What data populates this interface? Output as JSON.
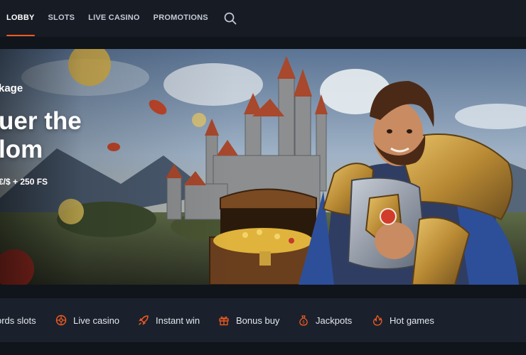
{
  "nav": {
    "items": [
      {
        "label": "LOBBY",
        "active": true
      },
      {
        "label": "SLOTS",
        "active": false
      },
      {
        "label": "LIVE CASINO",
        "active": false
      },
      {
        "label": "PROMOTIONS",
        "active": false
      }
    ],
    "search_icon": "search-icon"
  },
  "hero": {
    "kicker": "kage",
    "title_line1": "uer the",
    "title_line2": "lom",
    "offer": "€/$ + 250 FS"
  },
  "categories": [
    {
      "label": "ords slots",
      "icon": "none"
    },
    {
      "label": "Live casino",
      "icon": "roulette-icon"
    },
    {
      "label": "Instant win",
      "icon": "rocket-icon"
    },
    {
      "label": "Bonus buy",
      "icon": "gift-icon"
    },
    {
      "label": "Jackpots",
      "icon": "money-bag-icon"
    },
    {
      "label": "Hot games",
      "icon": "flame-icon"
    }
  ],
  "colors": {
    "accent": "#f25b20",
    "nav_bg": "#161b24",
    "category_bg": "#1b212c"
  }
}
